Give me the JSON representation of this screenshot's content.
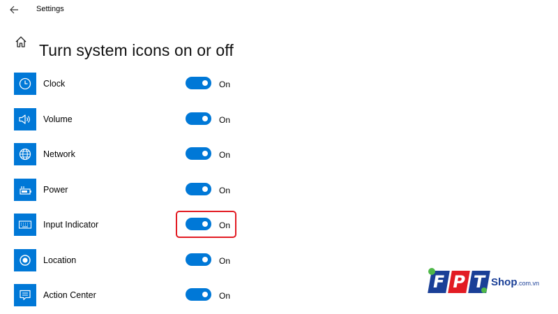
{
  "window": {
    "title": "Settings"
  },
  "page": {
    "title": "Turn system icons on or off"
  },
  "items": [
    {
      "label": "Clock",
      "icon": "clock-icon",
      "state": "On",
      "on": true
    },
    {
      "label": "Volume",
      "icon": "speaker-icon",
      "state": "On",
      "on": true
    },
    {
      "label": "Network",
      "icon": "globe-icon",
      "state": "On",
      "on": true
    },
    {
      "label": "Power",
      "icon": "battery-icon",
      "state": "On",
      "on": true
    },
    {
      "label": "Input Indicator",
      "icon": "keyboard-icon",
      "state": "On",
      "on": true,
      "highlighted": true
    },
    {
      "label": "Location",
      "icon": "location-icon",
      "state": "On",
      "on": true
    },
    {
      "label": "Action Center",
      "icon": "action-center-icon",
      "state": "On",
      "on": true
    }
  ],
  "colors": {
    "accent": "#0078d7",
    "highlight": "#e21b23"
  },
  "watermark": {
    "letters": [
      "F",
      "P",
      "T"
    ],
    "text": "Shop",
    "domain": ".com.vn"
  }
}
